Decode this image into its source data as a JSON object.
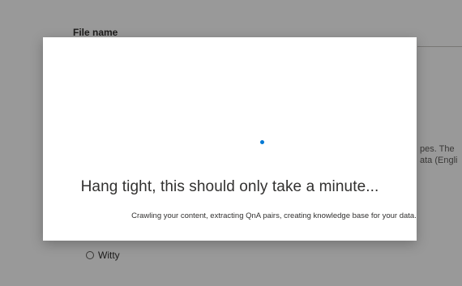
{
  "background": {
    "file_name_label": "File name",
    "side_text_line1": "pes. The",
    "side_text_line2": "ata (Engli",
    "radio_option": "Witty"
  },
  "modal": {
    "title": "Hang tight, this should only take a minute...",
    "subtitle": "Crawling your content, extracting QnA pairs, creating knowledge base for your data."
  },
  "colors": {
    "spinner": "#0078d4",
    "overlay": "rgba(0,0,0,0.4)"
  },
  "icons": {
    "spinner": "loading-spinner-icon"
  }
}
